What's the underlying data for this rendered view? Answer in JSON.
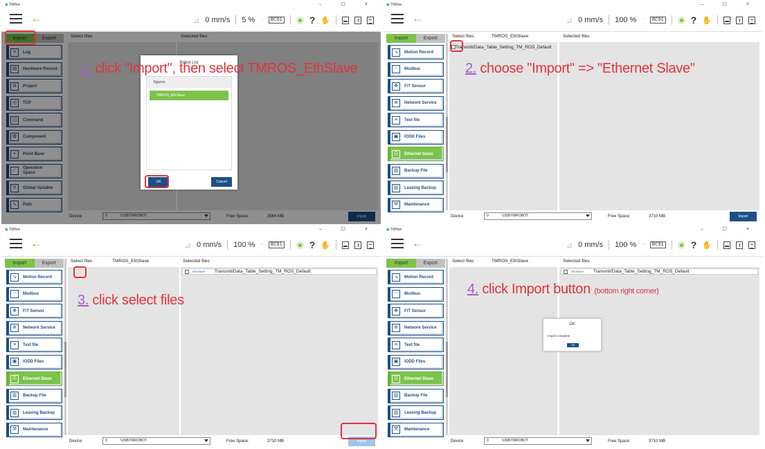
{
  "app": {
    "title": "TMflow",
    "win_controls": "– ☐ ×"
  },
  "panels": [
    {
      "speed": "0 mm/s",
      "percent": "5 %",
      "bc": "BC91"
    },
    {
      "speed": "0 mm/s",
      "percent": "100 %",
      "bc": "BC91"
    },
    {
      "speed": "0 mm/s",
      "percent": "100 %",
      "bc": "BC91"
    },
    {
      "speed": "0 mm/s",
      "percent": "100 %",
      "bc": "BC91"
    }
  ],
  "tabs": {
    "import": "Import",
    "export": "Export"
  },
  "sidebar1": [
    {
      "label": "Log",
      "icon": "≡"
    },
    {
      "label": "Hardware Record",
      "icon": "▤"
    },
    {
      "label": "Project",
      "icon": "⚙"
    },
    {
      "label": "TCP",
      "icon": "◎"
    },
    {
      "label": "Command",
      "icon": "◫"
    },
    {
      "label": "Component",
      "icon": "✿"
    },
    {
      "label": "Point Base",
      "icon": "⌖"
    },
    {
      "label": "Operation Space",
      "icon": "⁄"
    },
    {
      "label": "Global Variable",
      "icon": "V"
    },
    {
      "label": "Path",
      "icon": "∿"
    }
  ],
  "sidebar2": [
    {
      "label": "Motion Record",
      "icon": "↘"
    },
    {
      "label": "Modbus",
      "icon": "⁘"
    },
    {
      "label": "F/T Sensor",
      "icon": "✥"
    },
    {
      "label": "Network Service",
      "icon": "⊕"
    },
    {
      "label": "Text file",
      "icon": "≡"
    },
    {
      "label": "IODD Files",
      "icon": "▣"
    },
    {
      "label": "Ethernet Slave",
      "icon": "⎘"
    },
    {
      "label": "Backup File",
      "icon": "▥"
    },
    {
      "label": "Leasing Backup",
      "icon": "▥"
    },
    {
      "label": "Maintenance",
      "icon": "⚒"
    }
  ],
  "list": {
    "select_files": "Select files",
    "selected_files": "Selected files",
    "folder": "TMROS_EthSlave",
    "file_row": "Transmit/Data_Table_Setting_TM_ROS_Default",
    "file_tag": "EthSlave"
  },
  "bottom": {
    "device_label": "Device",
    "device_index": "0",
    "device_path": "\\USB\\TMROBOT",
    "free_space_label": "Free Space:",
    "free_space_1": "3564 MB",
    "free_space_rest": "3710 MB",
    "import_button": "Import"
  },
  "robot_list": {
    "title": "Robot List",
    "header": "figures",
    "option": "TMROS_EthSlave",
    "ok": "OK",
    "cancel": "Cancel"
  },
  "import_popup": {
    "title": "OK",
    "message": "Import complete",
    "button": "OK"
  },
  "notes": {
    "n1_num": "1.",
    "n1_text": " click \"Import\", then select TMROS_EthSlave",
    "n2_num": "2.",
    "n2_text": " choose \"Import\" => \"Ethernet Slave\"",
    "n3_num": "3.",
    "n3_text": "  click select files",
    "n4_num": "4.",
    "n4_text": " click Import button  ",
    "n4_small": "(bottom right corner)"
  }
}
